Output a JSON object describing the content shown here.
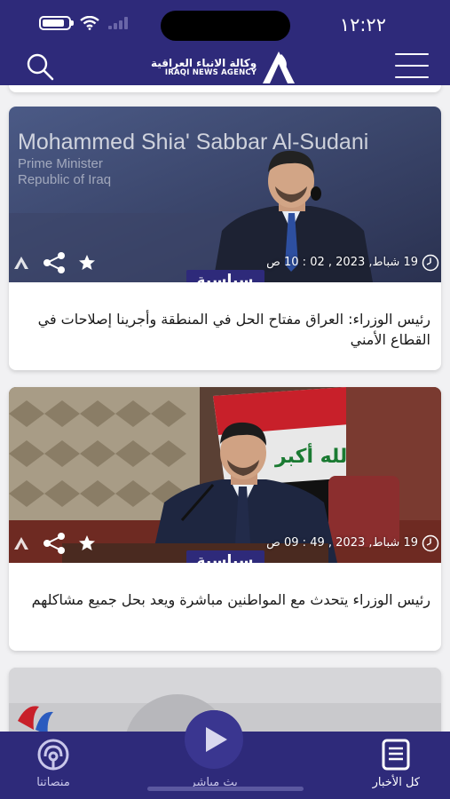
{
  "status_bar": {
    "time": "١٢:٢٢"
  },
  "header": {
    "logo_ar": "وكالة الانباء العراقية",
    "logo_en": "IRAQI NEWS AGENCY",
    "search_icon": "search-icon",
    "menu_icon": "hamburger-menu-icon"
  },
  "articles": [
    {
      "image_caption": "Mohammed Shia' Sabbar Al-Sudani",
      "image_sub1": "Prime Minister",
      "image_sub2": "Republic of Iraq",
      "date": "19 شباط, 2023 , 02 : 10 ص",
      "category": "سياسية",
      "title": "رئيس الوزراء: العراق مفتاح الحل في المنطقة وأجرينا إصلاحات في القطاع الأمني"
    },
    {
      "date": "19 شباط, 2023 , 49 : 09 ص",
      "category": "سياسية",
      "title": "رئيس الوزراء يتحدث مع المواطنين مباشرة ويعد بحل جميع مشاكلهم"
    }
  ],
  "bottom_nav": {
    "platforms": "منصاتنا",
    "live": "بث مباشر",
    "all_news": "كل الأخبار"
  },
  "colors": {
    "brand": "#2e2a7a"
  }
}
